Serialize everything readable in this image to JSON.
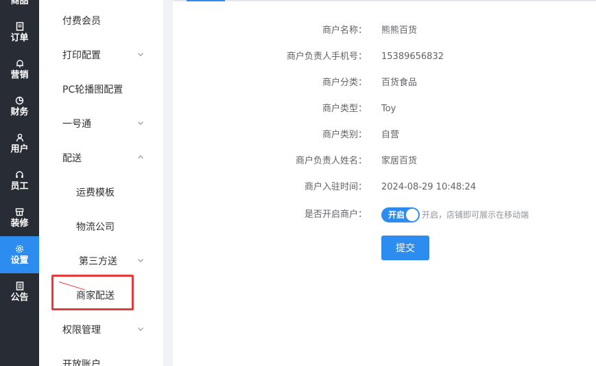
{
  "rail": {
    "items": [
      {
        "label": "商品",
        "icon": "goods-icon"
      },
      {
        "label": "订单",
        "icon": "order-icon"
      },
      {
        "label": "营销",
        "icon": "bell-icon"
      },
      {
        "label": "财务",
        "icon": "pie-chart-icon"
      },
      {
        "label": "用户",
        "icon": "user-icon"
      },
      {
        "label": "员工",
        "icon": "headset-icon"
      },
      {
        "label": "装修",
        "icon": "shop-icon"
      },
      {
        "label": "设置",
        "icon": "gear-icon"
      },
      {
        "label": "公告",
        "icon": "notice-icon"
      }
    ],
    "active": "设置"
  },
  "submenu": {
    "items": [
      {
        "label": "付费会员"
      },
      {
        "label": "打印配置"
      },
      {
        "label": "PC轮播图配置"
      },
      {
        "label": "一号通"
      },
      {
        "label": "配送"
      },
      {
        "label": "运费模板"
      },
      {
        "label": "物流公司"
      },
      {
        "label": "第三方送"
      },
      {
        "label": "商家配送"
      },
      {
        "label": "权限管理"
      },
      {
        "label": "开放账户"
      }
    ]
  },
  "form": {
    "fields": [
      {
        "label": "商户名称：",
        "value": "熊熊百货"
      },
      {
        "label": "商户负责人手机号：",
        "value": "15389656832"
      },
      {
        "label": "商户分类：",
        "value": "百货食品"
      },
      {
        "label": "商户类型：",
        "value": "Toy"
      },
      {
        "label": "商户类别：",
        "value": "自营"
      },
      {
        "label": "商户负责人姓名：",
        "value": "家居百货"
      },
      {
        "label": "商户入驻时间：",
        "value": "2024-08-29 10:48:24"
      }
    ],
    "open_label": "是否开启商户：",
    "switch_text": "开启",
    "switch_on": true,
    "switch_hint": "开启，店铺即可展示在移动端",
    "submit_label": "提交"
  },
  "colors": {
    "accent": "#2d8cf0",
    "rail_bg": "#282c34",
    "annotation": "#e53935"
  }
}
